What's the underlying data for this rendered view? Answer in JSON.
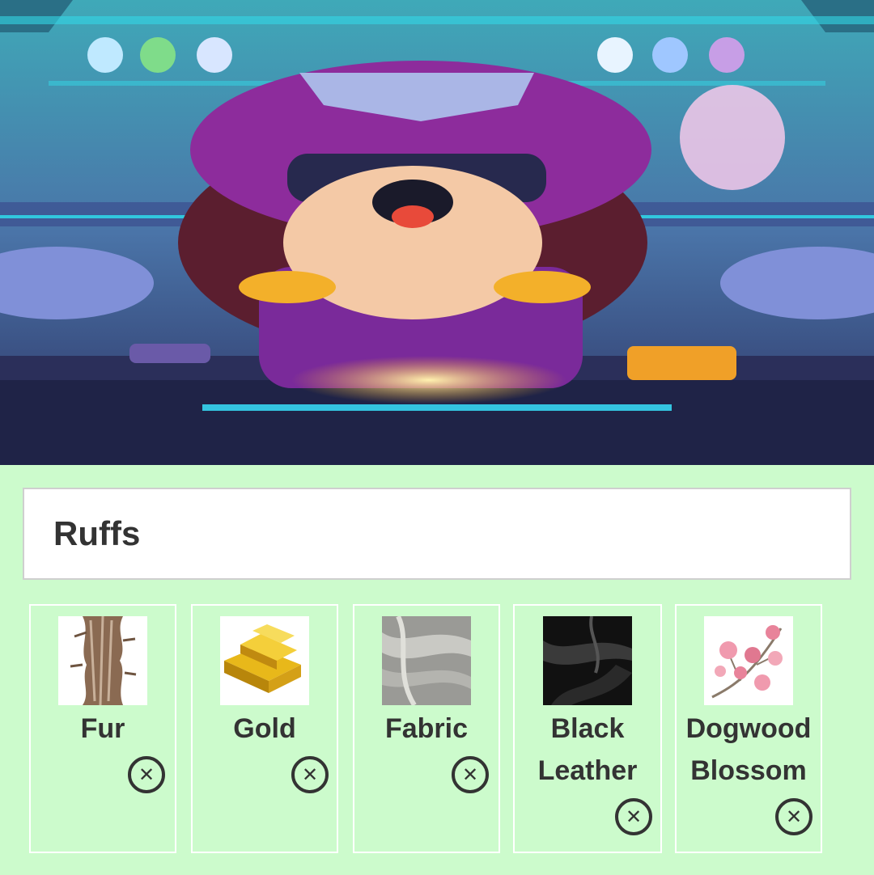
{
  "title": "Ruffs",
  "hero_image": "ruffs-character-banner",
  "colors": {
    "page_background": "#ccfbcc",
    "card_border": "#ffffff",
    "text": "#333333"
  },
  "materials": [
    {
      "label": "Fur",
      "thumbnail": "fur-swatch",
      "remove_icon": "close-circle-icon"
    },
    {
      "label": "Gold",
      "thumbnail": "gold-bars",
      "remove_icon": "close-circle-icon"
    },
    {
      "label": "Fabric",
      "thumbnail": "gray-fabric-swatch",
      "remove_icon": "close-circle-icon"
    },
    {
      "label": "Black Leather",
      "thumbnail": "black-leather-swatch",
      "remove_icon": "close-circle-icon"
    },
    {
      "label": "Dogwood Blossom",
      "thumbnail": "dogwood-blossom-branch",
      "remove_icon": "close-circle-icon"
    }
  ]
}
